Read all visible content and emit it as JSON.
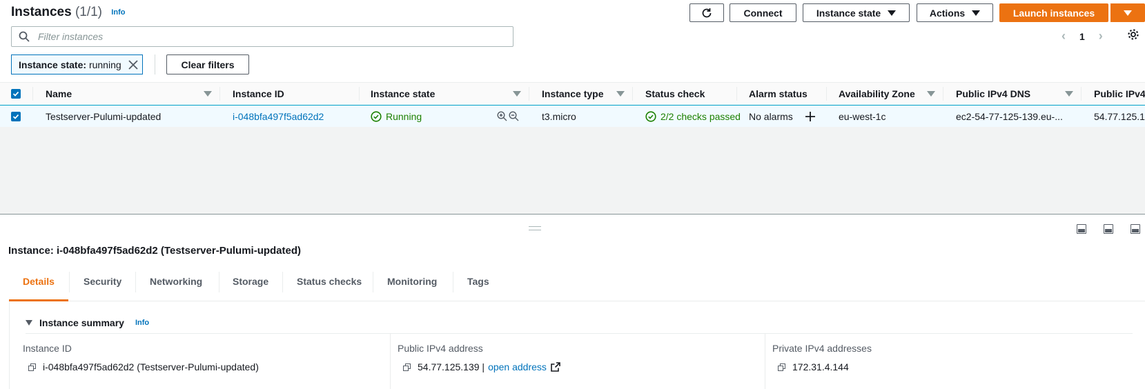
{
  "header": {
    "title": "Instances",
    "count": "(1/1)",
    "info": "Info"
  },
  "toolbar": {
    "connect": "Connect",
    "instance_state": "Instance state",
    "actions": "Actions",
    "launch": "Launch instances"
  },
  "search": {
    "placeholder": "Filter instances"
  },
  "pagination": {
    "page": "1"
  },
  "filter_token": {
    "key": "Instance state:",
    "value": "running"
  },
  "clear_filters": "Clear filters",
  "table": {
    "columns": [
      "Name",
      "Instance ID",
      "Instance state",
      "Instance type",
      "Status check",
      "Alarm status",
      "Availability Zone",
      "Public IPv4 DNS",
      "Public IPv4"
    ],
    "rows": [
      {
        "name": "Testserver-Pulumi-updated",
        "instance_id": "i-048bfa497f5ad62d2",
        "state": "Running",
        "type": "t3.micro",
        "status_check": "2/2 checks passed",
        "alarm_status": "No alarms",
        "az": "eu-west-1c",
        "dns": "ec2-54-77-125-139.eu-...",
        "ipv4": "54.77.125.1"
      }
    ]
  },
  "details": {
    "title": "Instance: i-048bfa497f5ad62d2 (Testserver-Pulumi-updated)",
    "tabs": [
      "Details",
      "Security",
      "Networking",
      "Storage",
      "Status checks",
      "Monitoring",
      "Tags"
    ],
    "summary_title": "Instance summary",
    "info": "Info",
    "fields": [
      {
        "label": "Instance ID",
        "value": "i-048bfa497f5ad62d2 (Testserver-Pulumi-updated)"
      },
      {
        "label": "Public IPv4 address",
        "value": "54.77.125.139 |",
        "link": "open address"
      },
      {
        "label": "Private IPv4 addresses",
        "value": "172.31.4.144"
      }
    ]
  },
  "colors": {
    "accent": "#ec7211",
    "link": "#0073bb",
    "success": "#1d8102",
    "selected_row": "#f1faff"
  },
  "icons": [
    "refresh-icon",
    "search-icon",
    "chevron-left-icon",
    "chevron-right-icon",
    "gear-icon",
    "close-icon",
    "checkbox-icon",
    "check-circle-icon",
    "zoom-in-icon",
    "zoom-out-icon",
    "plus-icon",
    "caret-down-icon",
    "copy-icon",
    "external-link-icon",
    "panel-icon"
  ]
}
